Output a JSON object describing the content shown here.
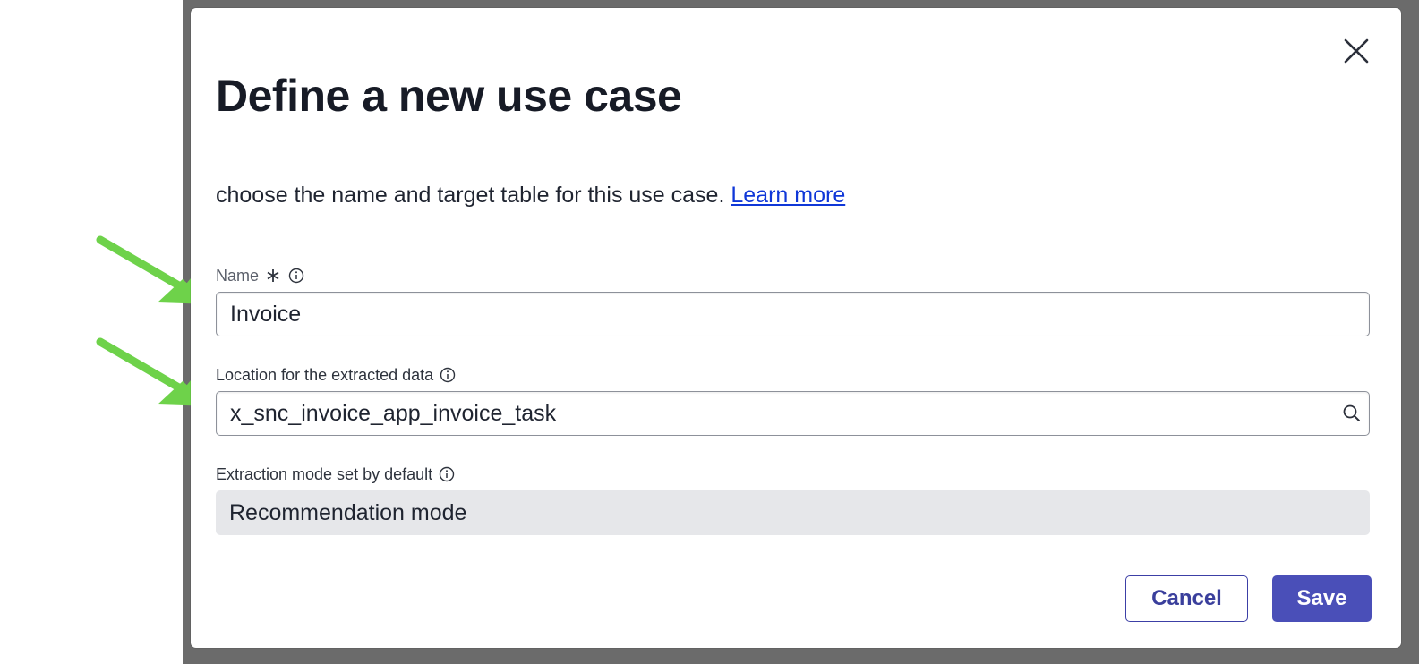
{
  "dialog": {
    "title": "Define a new use case",
    "description": "choose the name and target table for this use case.",
    "learn_more_link": "Learn more",
    "close_icon": "close-icon"
  },
  "fields": {
    "name": {
      "label": "Name",
      "required": true,
      "value": "Invoice"
    },
    "location": {
      "label": "Location for the extracted data",
      "value": "x_snc_invoice_app_invoice_task",
      "icon": "search-icon"
    },
    "extraction_mode": {
      "label": "Extraction mode set by default",
      "value": "Recommendation mode"
    }
  },
  "buttons": {
    "cancel": "Cancel",
    "save": "Save"
  },
  "colors": {
    "primary": "#4a4fb8",
    "link": "#0f37d8",
    "annotation_arrow": "#6ed24a",
    "readonly_bg": "#e6e7ea"
  }
}
